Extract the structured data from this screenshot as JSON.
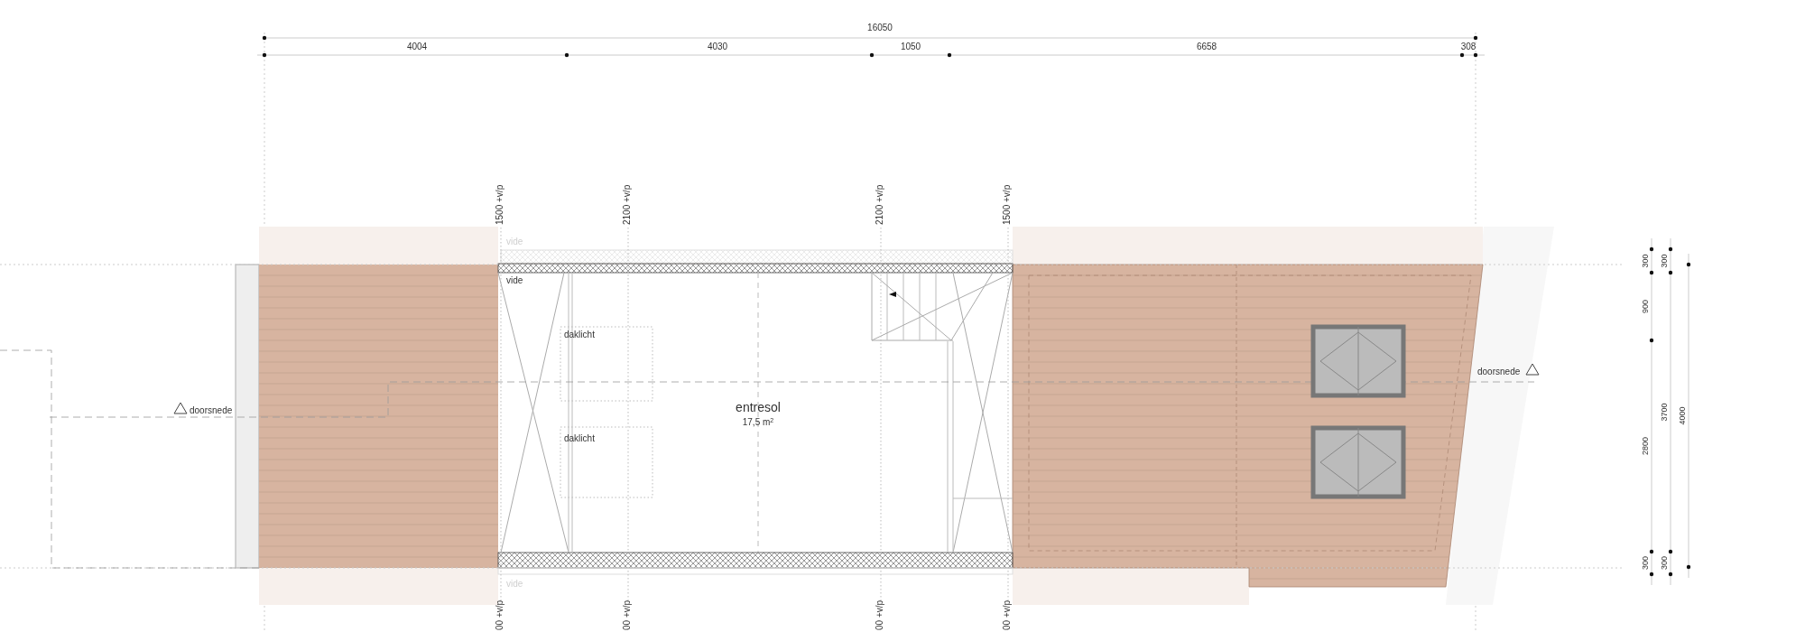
{
  "top_dimensions": {
    "overall": "16050",
    "segments": [
      "4004",
      "4030",
      "1050",
      "6658",
      "308"
    ]
  },
  "level_markers_top": [
    "1500 +v/p",
    "2100 +v/p",
    "2100 +v/p",
    "1500 +v/p"
  ],
  "level_markers_bottom": [
    "00 +v/p",
    "00 +v/p",
    "00 +v/p",
    "00 +v/p"
  ],
  "void_labels": [
    {
      "text": "vide",
      "faded": true
    },
    {
      "text": "vide",
      "faded": false
    },
    {
      "text": "vide",
      "faded": true
    }
  ],
  "skylight_labels": [
    "daklicht",
    "daklicht"
  ],
  "room": {
    "name": "entresol",
    "area": "17,5 m$^{2}$"
  },
  "section_markers": [
    "doorsnede",
    "doorsnede"
  ],
  "right_dimensions": {
    "inner": [
      "300",
      "900",
      "2800",
      "300"
    ],
    "middle": [
      "300",
      "3700",
      "300"
    ],
    "outer": [
      "4000"
    ]
  }
}
